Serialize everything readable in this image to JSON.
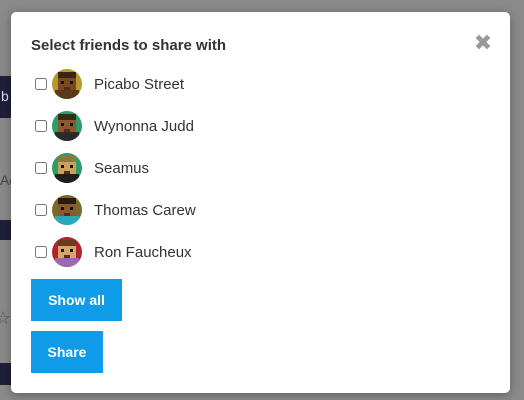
{
  "modal": {
    "title": "Select friends to share with",
    "close_glyph": "✖",
    "friends": [
      {
        "name": "Picabo Street",
        "avatar": "pixel-avatar",
        "checked": false,
        "colors": {
          "bg": "#b89a2c",
          "face": "#7a4a1e",
          "hair": "#3a2412",
          "shirt": "#5a3a1a"
        }
      },
      {
        "name": "Wynonna Judd",
        "avatar": "pixel-avatar",
        "checked": false,
        "colors": {
          "bg": "#2e9b6a",
          "face": "#8a5a2a",
          "hair": "#3a2a18",
          "shirt": "#2a2a2a"
        }
      },
      {
        "name": "Seamus",
        "avatar": "pixel-avatar",
        "checked": false,
        "colors": {
          "bg": "#2e9b6a",
          "face": "#c9a15a",
          "hair": "#8a7a3a",
          "shirt": "#1e1e1e"
        }
      },
      {
        "name": "Thomas Carew",
        "avatar": "pixel-avatar",
        "checked": false,
        "colors": {
          "bg": "#7a6a2a",
          "face": "#8a5a2a",
          "hair": "#2a1a10",
          "shirt": "#2ba8b8"
        }
      },
      {
        "name": "Ron Faucheux",
        "avatar": "pixel-avatar",
        "checked": false,
        "colors": {
          "bg": "#b0242a",
          "face": "#d9a46a",
          "hair": "#6a3a1a",
          "shirt": "#9a6ab0"
        }
      }
    ],
    "show_all_label": "Show all",
    "share_label": "Share"
  },
  "background": {
    "fragment_b": "b",
    "fragment_ac": "Ac"
  },
  "colors": {
    "accent": "#0e9be8",
    "overlay": "#8a8a8a"
  }
}
